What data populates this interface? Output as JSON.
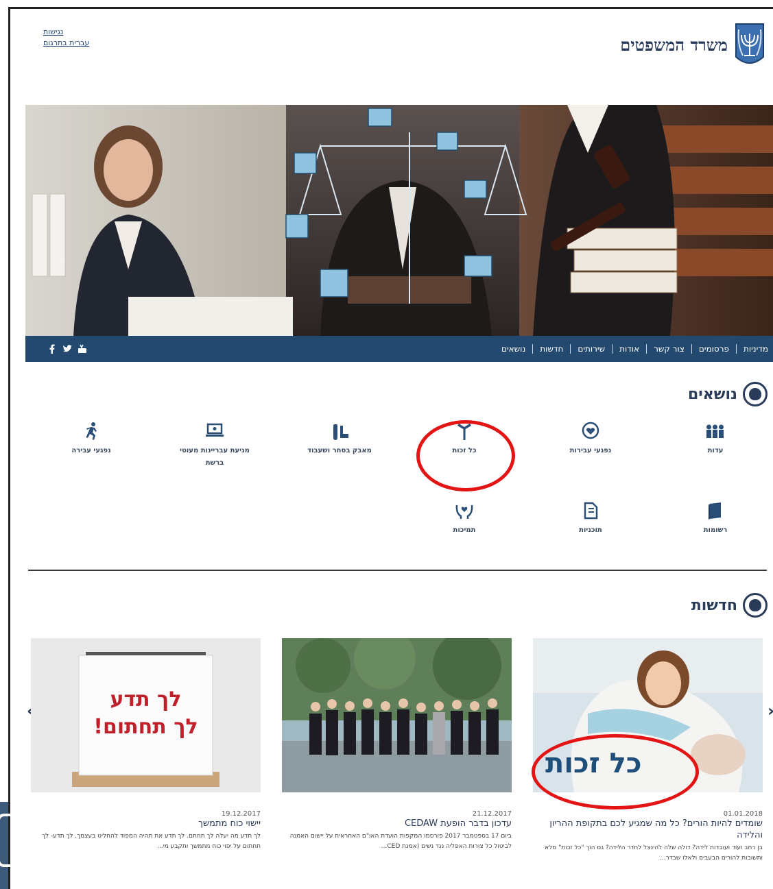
{
  "header": {
    "accessibility_links": [
      "נגישות",
      "עברית בתרגום"
    ],
    "ministry_name": "משרד המשפטים"
  },
  "nav": {
    "items": [
      "נושאים",
      "חדשות",
      "שירותים",
      "אודות",
      "צור קשר",
      "פרסומים",
      "מדיניות"
    ],
    "social_icons": [
      "facebook-icon",
      "twitter-icon",
      "youtube-icon"
    ]
  },
  "topics": {
    "title": "נושאים",
    "items": [
      {
        "label": "עדות",
        "icon": "people-icon"
      },
      {
        "label": "נפגעי עבירות",
        "icon": "heart-icon"
      },
      {
        "label": "כל זכות",
        "icon": "signpost-icon"
      },
      {
        "label": "מאבק בסחר ושעבוד",
        "icon": "handcuffs-icon"
      },
      {
        "label": "מניעת עבריינות מעוטי ברשת",
        "icon": "laptop-icon"
      },
      {
        "label": "נפגעי עבירה",
        "icon": "running-person-icon"
      },
      {
        "label": "רשומות",
        "icon": "books-icon"
      },
      {
        "label": "תוכניות",
        "icon": "document-icon"
      },
      {
        "label": "תמיכות",
        "icon": "hands-icon"
      }
    ]
  },
  "news": {
    "title": "חדשות",
    "cards": [
      {
        "date": "01.01.2018",
        "title": "שומדים להיות הורים? כל מה שמגיע לכם בתקופת ההריון והלידה",
        "desc": "בן רחב ועוד ועובדות לידה? דולה שלה להינצל לחדר הלידה? גם הוך \"כל זכות\" מלא ותשובות להורים הבעבים ולאלו שבדר...",
        "overlay_text": "כל זכות"
      },
      {
        "date": "21.12.2017",
        "title": "עדכון בדבר הופעת CEDAW",
        "desc": "ביום 17 בספטמבר 2017 פורסמו המקפות הועדת האו\"ם האחראית על יישום האמנה לביטול כל צורות האפליה נגד נשים (אמנת CED...",
        "overlay_text": ""
      },
      {
        "date": "19.12.2017",
        "title": "יישוי כוח מתמשך",
        "desc": "לך תדע מה יעלה לך תחתם. לך תדע את תהיה המפוד להחליט בעצמך. לך תדע- לך תחתום על יפוי כוח מתמשך ותקבע מי...",
        "overlay_text": "לך תדע\nלך תחתום!"
      }
    ]
  },
  "colors": {
    "nav_bg": "#234a6e",
    "accent": "#2a3b5a",
    "highlight_circle": "#e31414"
  }
}
